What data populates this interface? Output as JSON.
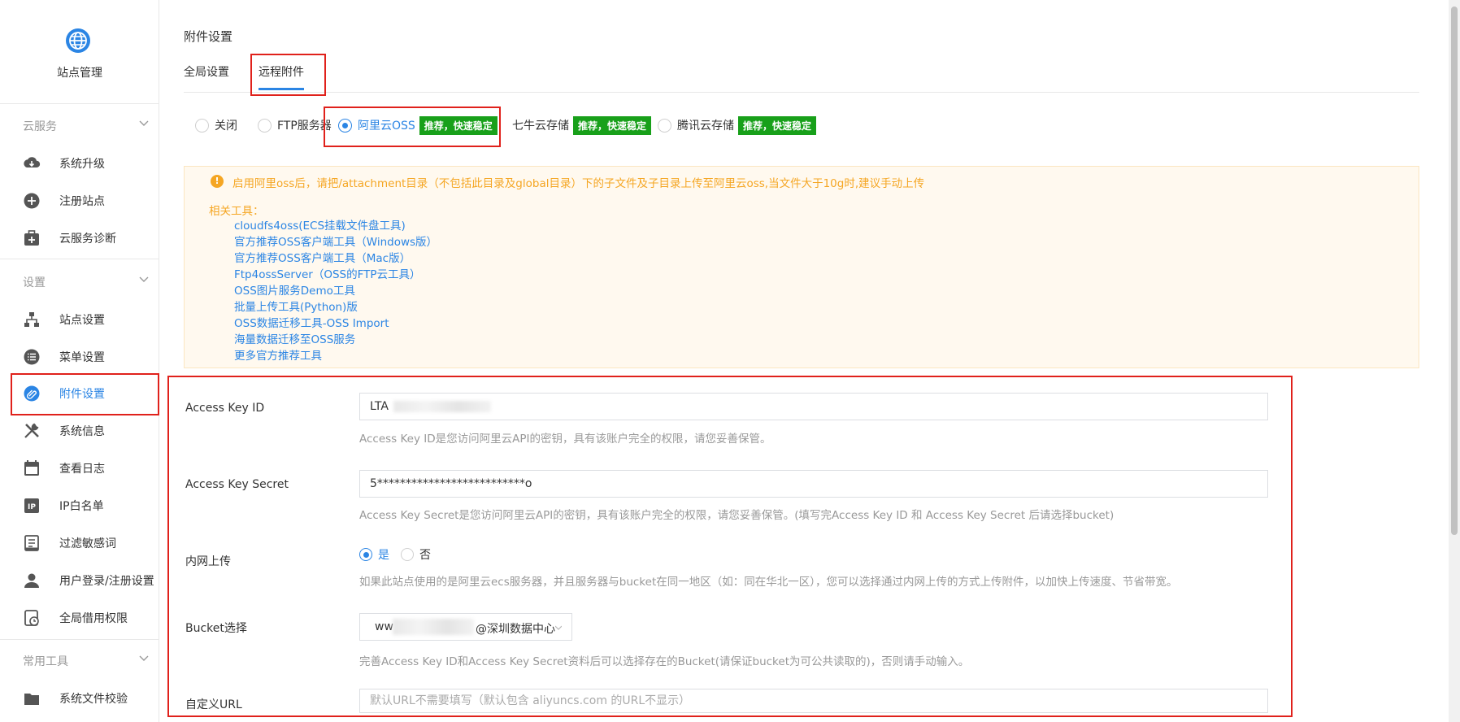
{
  "sidebar": {
    "site_name": "站点管理",
    "groups": [
      {
        "title": "云服务",
        "items": [
          "系统升级",
          "注册站点",
          "云服务诊断"
        ]
      },
      {
        "title": "设置",
        "items": [
          "站点设置",
          "菜单设置",
          "附件设置",
          "系统信息",
          "查看日志",
          "IP白名单",
          "过滤敏感词",
          "用户登录/注册设置",
          "全局借用权限"
        ]
      },
      {
        "title": "常用工具",
        "items": [
          "系统文件校验"
        ]
      }
    ],
    "active_item": "附件设置"
  },
  "page": {
    "title": "附件设置",
    "tabs": [
      "全局设置",
      "远程附件"
    ],
    "active_tab": "远程附件"
  },
  "storage_options": {
    "selected": "阿里云OSS",
    "options": [
      {
        "label": "关闭",
        "tag": ""
      },
      {
        "label": "FTP服务器",
        "tag": ""
      },
      {
        "label": "阿里云OSS",
        "tag": "推荐，快速稳定"
      },
      {
        "label": "七牛云存储",
        "tag": "推荐，快速稳定"
      },
      {
        "label": "腾讯云存储",
        "tag": "推荐，快速稳定"
      }
    ]
  },
  "notice": {
    "text": "启用阿里oss后，请把/attachment目录（不包括此目录及global目录）下的子文件及子目录上传至阿里云oss,当文件大于10g时,建议手动上传",
    "tools_title": "相关工具：",
    "tools": [
      "cloudfs4oss(ECS挂载文件盘工具)",
      "官方推荐OSS客户端工具（Windows版）",
      "官方推荐OSS客户端工具（Mac版）",
      "Ftp4ossServer（OSS的FTP云工具）",
      "OSS图片服务Demo工具",
      "批量上传工具(Python)版",
      "OSS数据迁移工具-OSS Import",
      "海量数据迁移至OSS服务",
      "更多官方推荐工具"
    ]
  },
  "form": {
    "access_key_id": {
      "label": "Access Key ID",
      "value": "LTA",
      "help": "Access Key ID是您访问阿里云API的密钥，具有该账户完全的权限，请您妥善保管。"
    },
    "access_key_secret": {
      "label": "Access Key Secret",
      "value": "5**************************o",
      "help": "Access Key Secret是您访问阿里云API的密钥，具有该账户完全的权限，请您妥善保管。(填写完Access Key ID 和 Access Key Secret 后请选择bucket)"
    },
    "intranet_upload": {
      "label": "内网上传",
      "yes": "是",
      "no": "否",
      "selected": "是",
      "help": "如果此站点使用的是阿里云ecs服务器，并且服务器与bucket在同一地区（如：同在华北一区），您可以选择通过内网上传的方式上传附件，以加快上传速度、节省带宽。"
    },
    "bucket": {
      "label": "Bucket选择",
      "value_prefix": "ww",
      "value_suffix": "@深圳数据中心",
      "help": "完善Access Key ID和Access Key Secret资料后可以选择存在的Bucket(请保证bucket为可公共读取的)，否则请手动输入。"
    },
    "custom_url": {
      "label": "自定义URL",
      "placeholder": "默认URL不需要填写（默认包含 aliyuncs.com 的URL不显示）"
    }
  },
  "colors": {
    "accent": "#2b85e4",
    "tag_green": "#18a01a",
    "warning": "#f5a623",
    "highlight_red": "#e0211b"
  }
}
